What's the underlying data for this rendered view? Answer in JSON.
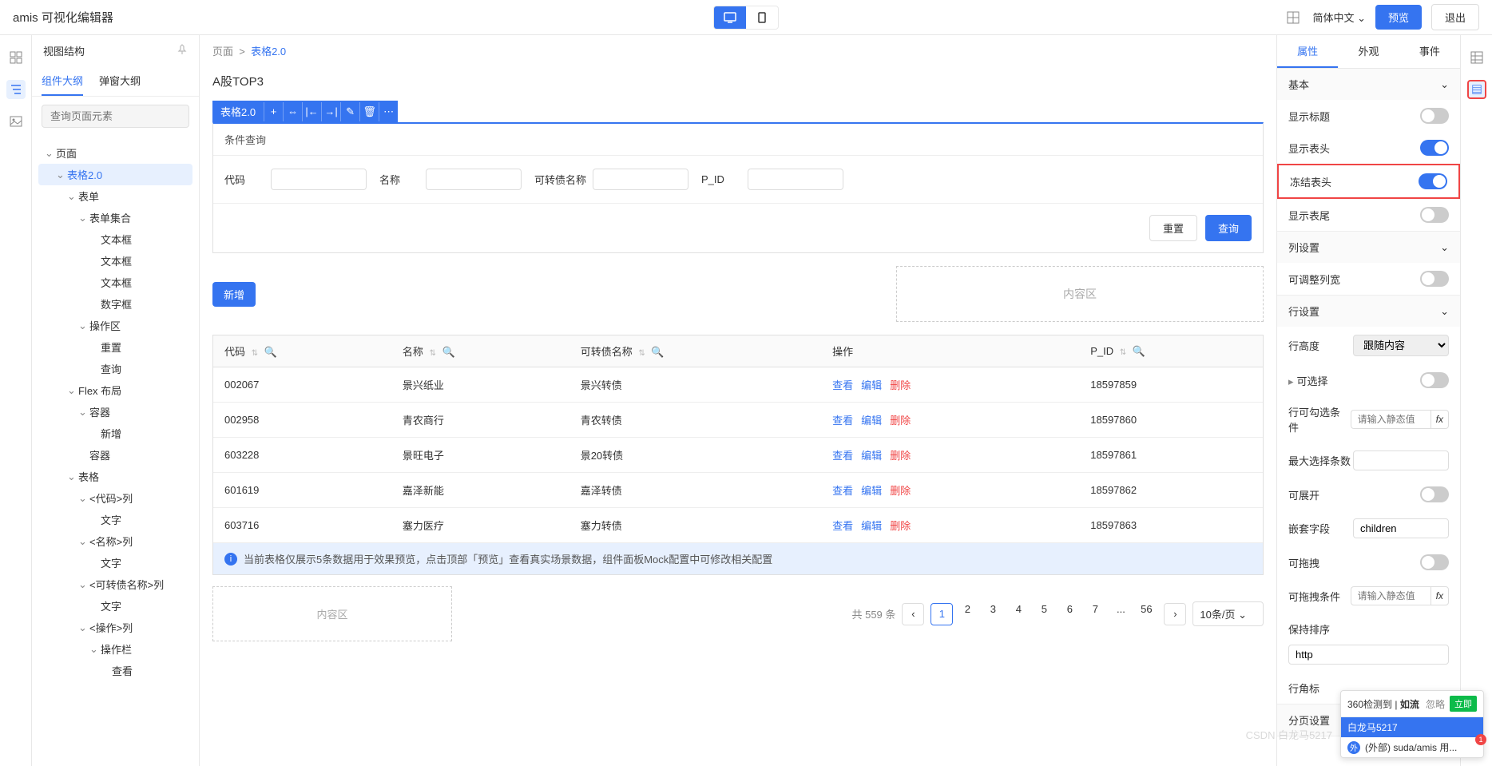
{
  "header": {
    "title": "amis 可视化编辑器",
    "lang": "简体中文",
    "preview": "预览",
    "exit": "退出"
  },
  "left_panel": {
    "title": "视图结构",
    "tabs": [
      "组件大纲",
      "弹窗大纲"
    ],
    "search_placeholder": "查询页面元素",
    "tree": [
      {
        "label": "页面",
        "indent": 0,
        "chevron": "⌄"
      },
      {
        "label": "表格2.0",
        "indent": 1,
        "chevron": "⌄",
        "selected": true
      },
      {
        "label": "表单",
        "indent": 2,
        "chevron": "⌄"
      },
      {
        "label": "表单集合",
        "indent": 3,
        "chevron": "⌄"
      },
      {
        "label": "文本框",
        "indent": 4
      },
      {
        "label": "文本框",
        "indent": 4
      },
      {
        "label": "文本框",
        "indent": 4
      },
      {
        "label": "数字框",
        "indent": 4
      },
      {
        "label": "操作区",
        "indent": 3,
        "chevron": "⌄"
      },
      {
        "label": "重置",
        "indent": 4
      },
      {
        "label": "查询",
        "indent": 4
      },
      {
        "label": "Flex 布局",
        "indent": 2,
        "chevron": "⌄"
      },
      {
        "label": "容器",
        "indent": 3,
        "chevron": "⌄"
      },
      {
        "label": "新增",
        "indent": 4
      },
      {
        "label": "容器",
        "indent": 3
      },
      {
        "label": "表格",
        "indent": 2,
        "chevron": "⌄"
      },
      {
        "label": "<代码>列",
        "indent": 3,
        "chevron": "⌄"
      },
      {
        "label": "文字",
        "indent": 4
      },
      {
        "label": "<名称>列",
        "indent": 3,
        "chevron": "⌄"
      },
      {
        "label": "文字",
        "indent": 4
      },
      {
        "label": "<可转债名称>列",
        "indent": 3,
        "chevron": "⌄"
      },
      {
        "label": "文字",
        "indent": 4
      },
      {
        "label": "<操作>列",
        "indent": 3,
        "chevron": "⌄"
      },
      {
        "label": "操作栏",
        "indent": 4,
        "chevron": "⌄"
      },
      {
        "label": "查看",
        "indent": 5
      }
    ]
  },
  "breadcrumb": {
    "parts": [
      "页面",
      "表格2.0"
    ]
  },
  "page": {
    "title": "A股TOP3",
    "component_label": "表格2.0",
    "query_title": "条件查询",
    "fields": [
      {
        "label": "代码"
      },
      {
        "label": "名称"
      },
      {
        "label": "可转债名称"
      },
      {
        "label": "P_ID"
      }
    ],
    "reset": "重置",
    "query": "查询",
    "add": "新增",
    "placeholder": "内容区",
    "columns": [
      "代码",
      "名称",
      "可转债名称",
      "操作",
      "P_ID"
    ],
    "rows": [
      {
        "code": "002067",
        "name": "景兴纸业",
        "bond": "景兴转债",
        "pid": "18597859"
      },
      {
        "code": "002958",
        "name": "青农商行",
        "bond": "青农转债",
        "pid": "18597860"
      },
      {
        "code": "603228",
        "name": "景旺电子",
        "bond": "景20转债",
        "pid": "18597861"
      },
      {
        "code": "601619",
        "name": "嘉泽新能",
        "bond": "嘉泽转债",
        "pid": "18597862"
      },
      {
        "code": "603716",
        "name": "塞力医疗",
        "bond": "塞力转债",
        "pid": "18597863"
      }
    ],
    "actions": {
      "view": "查看",
      "edit": "编辑",
      "delete": "删除"
    },
    "info": "当前表格仅展示5条数据用于效果预览，点击顶部「预览」查看真实场景数据，组件面板Mock配置中可修改相关配置",
    "pagination": {
      "total": "共 559 条",
      "pages": [
        "1",
        "2",
        "3",
        "4",
        "5",
        "6",
        "7",
        "...",
        "56"
      ],
      "page_size": "10条/页"
    }
  },
  "right_panel": {
    "tabs": [
      "属性",
      "外观",
      "事件"
    ],
    "sections": {
      "basic": {
        "title": "基本",
        "show_title": "显示标题",
        "show_header": "显示表头",
        "freeze_header": "冻结表头",
        "show_footer": "显示表尾"
      },
      "col": {
        "title": "列设置",
        "adjustable": "可调整列宽"
      },
      "row": {
        "title": "行设置",
        "height": "行高度",
        "height_value": "跟随内容",
        "selectable": "可选择",
        "check_condition": "行可勾选条件",
        "max_select": "最大选择条数",
        "expandable": "可展开",
        "nested_field": "嵌套字段",
        "nested_value": "children",
        "draggable": "可拖拽",
        "drag_condition": "可拖拽条件",
        "keep_order": "保持排序",
        "keep_order_value": "http",
        "corner": "行角标"
      },
      "paging": {
        "title": "分页设置"
      }
    },
    "placeholder_static": "请输入静态值"
  },
  "notif": {
    "title": "360检测到",
    "app": "如流",
    "ignore": "忽略",
    "immediate": "立即",
    "user": "白龙马5217",
    "item": "(外部) suda/amis 用..."
  },
  "watermark": "CSDN 白龙马5217"
}
